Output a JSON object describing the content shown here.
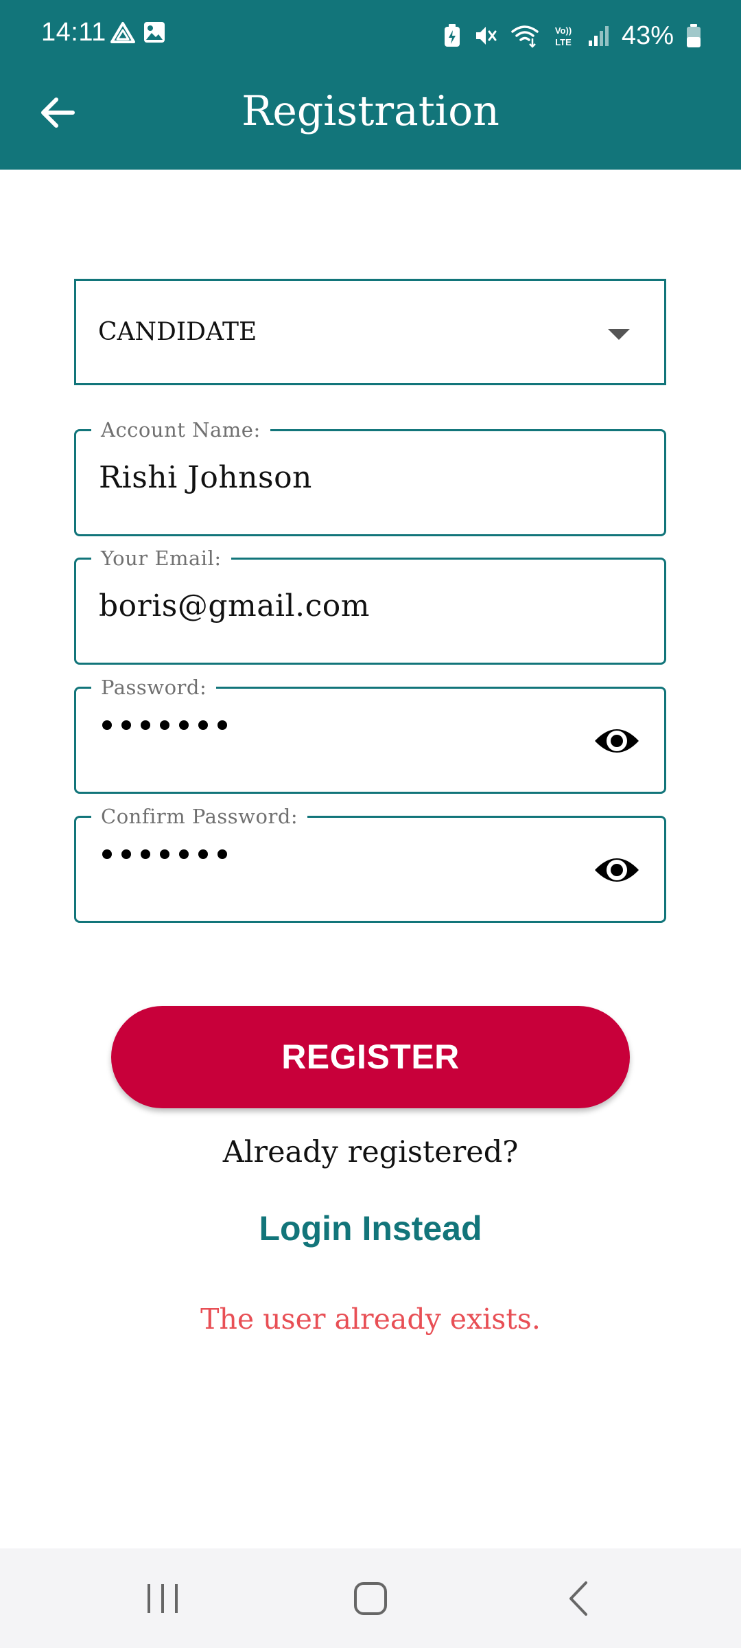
{
  "status_bar": {
    "time": "14:11",
    "battery": "43%",
    "icons": [
      "drive-icon",
      "image-icon",
      "battery-saver-icon",
      "mute-icon",
      "wifi-icon",
      "volte-icon",
      "signal-icon",
      "battery-icon"
    ]
  },
  "header": {
    "title": "Registration",
    "back_icon": "arrow-left-icon"
  },
  "form": {
    "role_select": {
      "value": "CANDIDATE"
    },
    "account_name": {
      "label": "Account Name:",
      "value": "Rishi Johnson"
    },
    "email": {
      "label": "Your Email:",
      "value": "boris@gmail.com"
    },
    "password": {
      "label": "Password:",
      "masked_length": 7
    },
    "confirm_password": {
      "label": "Confirm Password:",
      "masked_length": 7
    }
  },
  "actions": {
    "register_label": "REGISTER",
    "already_registered": "Already registered?",
    "login_link": "Login Instead"
  },
  "error": {
    "message": "The user already exists."
  },
  "colors": {
    "primary": "#12757a",
    "accent": "#c8003a",
    "error": "#e84f55"
  }
}
